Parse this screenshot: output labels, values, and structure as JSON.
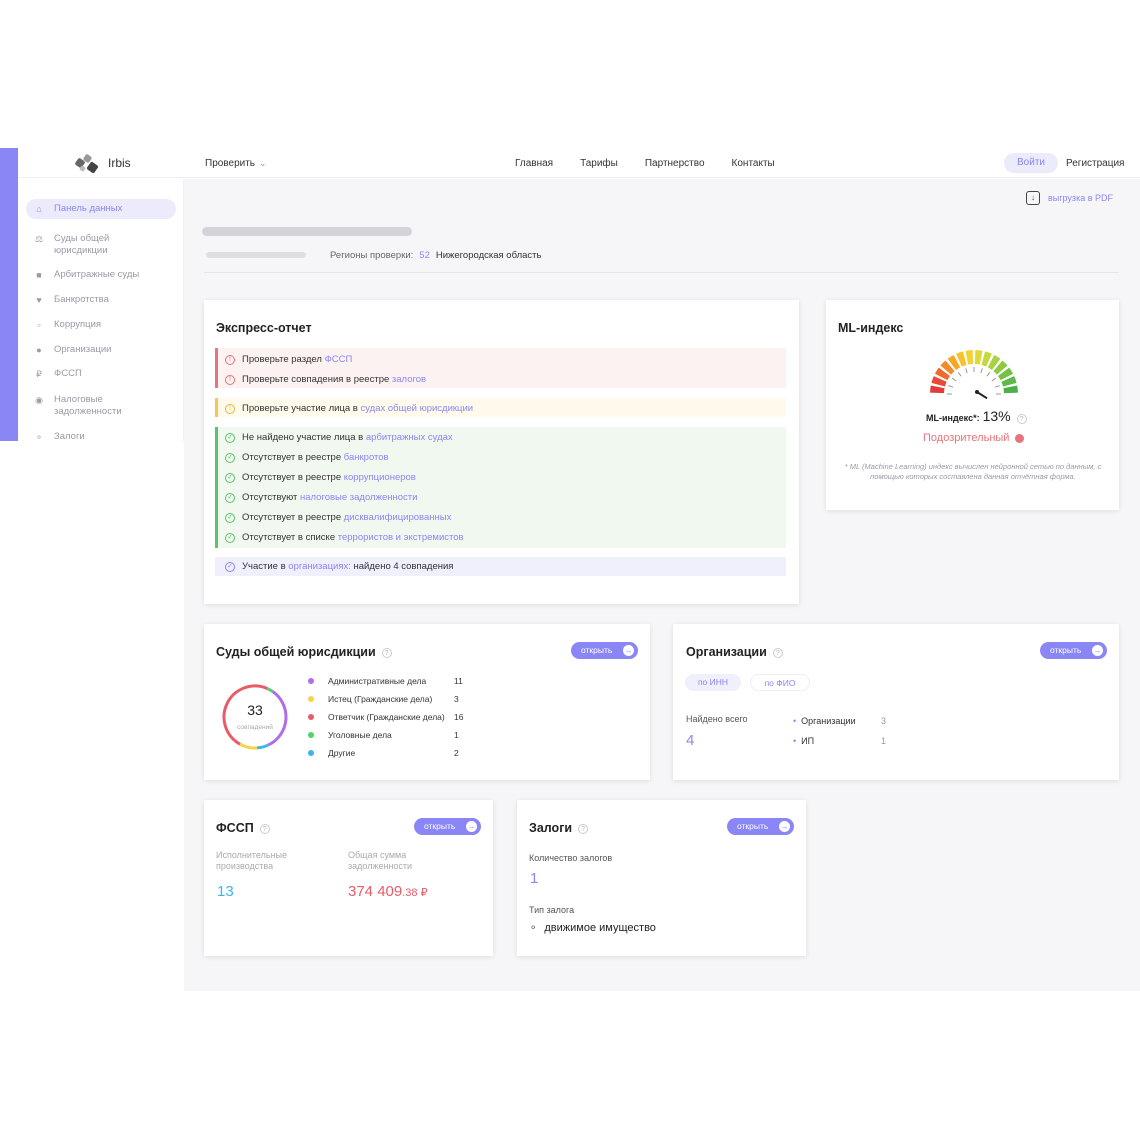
{
  "header": {
    "brand": "Irbis",
    "check_menu": "Проверить",
    "nav": [
      "Главная",
      "Тарифы",
      "Партнерство",
      "Контакты"
    ],
    "login": "Войти",
    "register": "Регистрация"
  },
  "sidebar": {
    "items": [
      {
        "label": "Панель данных",
        "icon": "home-icon"
      },
      {
        "label": "Суды общей юрисдикции",
        "icon": "scales-icon"
      },
      {
        "label": "Арбитражные суды",
        "icon": "court-icon"
      },
      {
        "label": "Банкротства",
        "icon": "broken-heart-icon"
      },
      {
        "label": "Коррупция",
        "icon": "money-icon"
      },
      {
        "label": "Организации",
        "icon": "people-icon"
      },
      {
        "label": "ФССП",
        "icon": "ruble-icon"
      },
      {
        "label": "Налоговые задолженности",
        "icon": "money-bag-icon"
      },
      {
        "label": "Залоги",
        "icon": "vehicle-icon"
      }
    ]
  },
  "top": {
    "pdf": "выгрузка в PDF",
    "regions_label": "Регионы проверки:",
    "regions_count": "52",
    "region_name": "Нижегородская область"
  },
  "express": {
    "title": "Экспресс-отчет",
    "red": [
      {
        "text": "Проверьте раздел ",
        "link": "ФССП"
      },
      {
        "text": "Проверьте совпадения в реестре ",
        "link": "залогов"
      }
    ],
    "yellow": [
      {
        "text": "Проверьте участие лица в ",
        "link": "судах общей юрисдикции"
      }
    ],
    "green": [
      {
        "text": "Не найдено участие лица в ",
        "link": "арбитражных судах"
      },
      {
        "text": "Отсутствует в реестре ",
        "link": "банкротов"
      },
      {
        "text": "Отсутствует в реестре ",
        "link": "коррупционеров"
      },
      {
        "text": "Отсутствуют ",
        "link": "налоговые задолженности"
      },
      {
        "text": "Отсутствует в реестре ",
        "link": "дисквалифицированных"
      },
      {
        "text": "Отсутствует в списке ",
        "link": "террористов и экстремистов"
      }
    ],
    "purple": {
      "text": "Участие в ",
      "link": "организациях:",
      "suffix": " найдено 4 совпадения"
    }
  },
  "ml": {
    "title": "ML-индекс",
    "label": "ML-индекс*:",
    "value": "13%",
    "value_fraction": 0.13,
    "status": "Подозрительный",
    "note": "* ML (Machine Learning) индекс вычислен нейронной сетью по данным, с помощью которых составлена данная отчётная форма."
  },
  "courts": {
    "title": "Суды общей юрисдикции",
    "open": "открыть",
    "total": "33",
    "total_label": "совпадений",
    "legend": [
      {
        "label": "Административные дела",
        "value": "11",
        "color": "#b06de8"
      },
      {
        "label": "Истец (Гражданские дела)",
        "value": "3",
        "color": "#f5d547"
      },
      {
        "label": "Ответчик (Гражданские дела)",
        "value": "16",
        "color": "#e85c6a"
      },
      {
        "label": "Уголовные дела",
        "value": "1",
        "color": "#4fd36a"
      },
      {
        "label": "Другие",
        "value": "2",
        "color": "#3bb6e8"
      }
    ]
  },
  "orgs": {
    "title": "Организации",
    "open": "открыть",
    "chip_inn": "по ИНН",
    "chip_fio": "по ФИО",
    "found_label": "Найдено всего",
    "found_value": "4",
    "rows": [
      {
        "label": "Организации",
        "value": "3"
      },
      {
        "label": "ИП",
        "value": "1"
      }
    ]
  },
  "fssp": {
    "title": "ФССП",
    "open": "открыть",
    "proc_label": "Исполнительные производства",
    "proc_value": "13",
    "sum_label": "Общая сумма задолженности",
    "sum_int": "374 409",
    "sum_dec": ".38 ₽"
  },
  "pledges": {
    "title": "Залоги",
    "open": "открыть",
    "count_label": "Количество залогов",
    "count_value": "1",
    "type_label": "Тип залога",
    "type_value": "движимое имущество"
  },
  "colors": {
    "accent": "#8a86f5",
    "danger": "#e7737c",
    "warn": "#f5c94a",
    "ok": "#5cc36b"
  }
}
